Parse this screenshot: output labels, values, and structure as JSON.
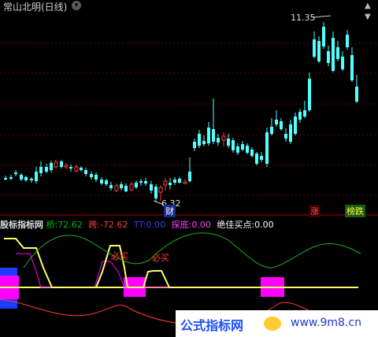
{
  "header": {
    "title": "常山北明(日线)",
    "collapse_icon": "chevron-down-icon"
  },
  "main_chart": {
    "high_label": "11.35",
    "low_label": "6.32",
    "event_badge": "财",
    "rise_badge": "涨",
    "list_badge": "榜跌",
    "colors": {
      "up": "#ff3b3b",
      "down": "#54ffff",
      "grid": "#7a0000"
    }
  },
  "indicator_bar": {
    "name": "股标指标网",
    "items": [
      {
        "label": "桥:",
        "value": "72.62",
        "color": "#00c000"
      },
      {
        "label": "跨:",
        "value": "-72.62",
        "color": "#ff3b3b"
      },
      {
        "label": "TT:",
        "value": "0.00",
        "color": "#3a3aff"
      },
      {
        "label": "探底:",
        "value": "0.00",
        "color": "#ff40ff"
      },
      {
        "label": "绝佳买点:",
        "value": "0.00",
        "color": "#ffffff"
      }
    ]
  },
  "signals": {
    "buy_label_1": "必买",
    "buy_label_2": "必买"
  },
  "watermark": {
    "site_name": "公式指标网",
    "url": "www.9m8.cn"
  }
}
